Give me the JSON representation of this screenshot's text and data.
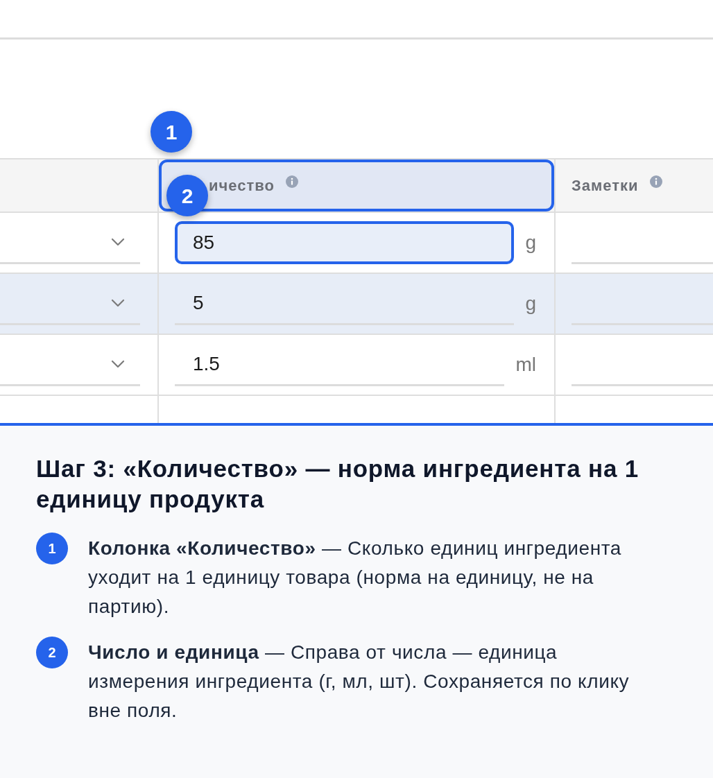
{
  "markers": [
    {
      "number": "1"
    },
    {
      "number": "2"
    }
  ],
  "table": {
    "columns": [
      {
        "label": "ичество",
        "highlighted": true
      },
      {
        "label": "Заметки",
        "highlighted": false
      }
    ],
    "rows": [
      {
        "quantity": "85",
        "unit": "g",
        "focused": true,
        "highlighted": false
      },
      {
        "quantity": "5",
        "unit": "g",
        "focused": false,
        "highlighted": true
      },
      {
        "quantity": "1.5",
        "unit": "ml",
        "focused": false,
        "highlighted": false
      }
    ]
  },
  "help_panel": {
    "title": "Шаг 3: «Количество» — норма ингредиента на 1 единицу продукта",
    "steps": [
      {
        "number": "1",
        "text": "**Колонка «Количество»** — Сколько единиц ингредиента уходит на 1 единицу товара (норма на единицу, не на партию)."
      },
      {
        "number": "2",
        "text": "**Число и единица** — Справа от числа — единица измерения ингредиента (г, мл, шт). Сохраняется по клику вне поля."
      }
    ]
  }
}
